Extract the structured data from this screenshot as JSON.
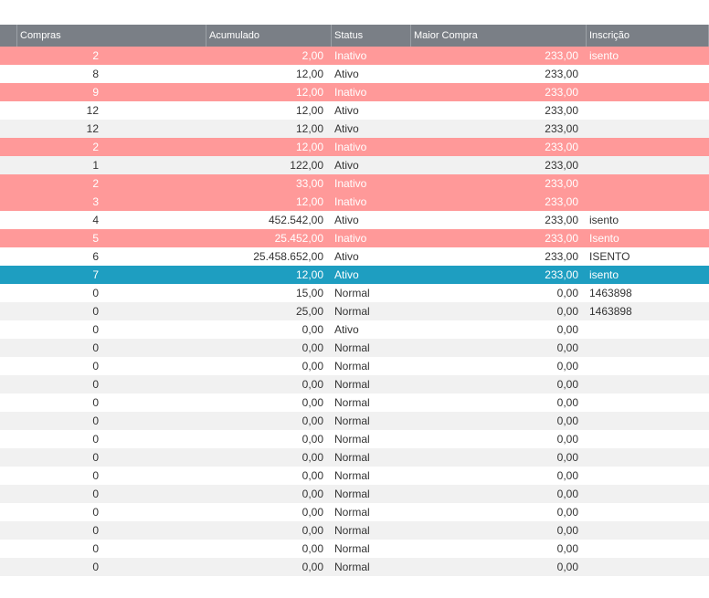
{
  "columns": {
    "compras": "Compras",
    "acumulado": "Acumulado",
    "status": "Status",
    "maior_compra": "Maior Compra",
    "inscricao": "Inscrição"
  },
  "rows": [
    {
      "compras": "2",
      "acumulado": "2,00",
      "status": "Inativo",
      "maior_compra": "233,00",
      "inscricao": "isento",
      "style": "inativo"
    },
    {
      "compras": "8",
      "acumulado": "12,00",
      "status": "Ativo",
      "maior_compra": "233,00",
      "inscricao": "",
      "style": "even"
    },
    {
      "compras": "9",
      "acumulado": "12,00",
      "status": "Inativo",
      "maior_compra": "233,00",
      "inscricao": "",
      "style": "inativo"
    },
    {
      "compras": "12",
      "acumulado": "12,00",
      "status": "Ativo",
      "maior_compra": "233,00",
      "inscricao": "",
      "style": "even"
    },
    {
      "compras": "12",
      "acumulado": "12,00",
      "status": "Ativo",
      "maior_compra": "233,00",
      "inscricao": "",
      "style": "odd"
    },
    {
      "compras": "2",
      "acumulado": "12,00",
      "status": "Inativo",
      "maior_compra": "233,00",
      "inscricao": "",
      "style": "inativo"
    },
    {
      "compras": "1",
      "acumulado": "122,00",
      "status": "Ativo",
      "maior_compra": "233,00",
      "inscricao": "",
      "style": "odd"
    },
    {
      "compras": "2",
      "acumulado": "33,00",
      "status": "Inativo",
      "maior_compra": "233,00",
      "inscricao": "",
      "style": "inativo"
    },
    {
      "compras": "3",
      "acumulado": "12,00",
      "status": "Inativo",
      "maior_compra": "233,00",
      "inscricao": "",
      "style": "inativo"
    },
    {
      "compras": "4",
      "acumulado": "452.542,00",
      "status": "Ativo",
      "maior_compra": "233,00",
      "inscricao": "isento",
      "style": "even"
    },
    {
      "compras": "5",
      "acumulado": "25.452,00",
      "status": "Inativo",
      "maior_compra": "233,00",
      "inscricao": "Isento",
      "style": "inativo"
    },
    {
      "compras": "6",
      "acumulado": "25.458.652,00",
      "status": "Ativo",
      "maior_compra": "233,00",
      "inscricao": "ISENTO",
      "style": "even"
    },
    {
      "compras": "7",
      "acumulado": "12,00",
      "status": "Ativo",
      "maior_compra": "233,00",
      "inscricao": "isento",
      "style": "selected"
    },
    {
      "compras": "0",
      "acumulado": "15,00",
      "status": "Normal",
      "maior_compra": "0,00",
      "inscricao": "1463898",
      "style": "even"
    },
    {
      "compras": "0",
      "acumulado": "25,00",
      "status": "Normal",
      "maior_compra": "0,00",
      "inscricao": "1463898",
      "style": "odd"
    },
    {
      "compras": "0",
      "acumulado": "0,00",
      "status": "Ativo",
      "maior_compra": "0,00",
      "inscricao": "",
      "style": "even"
    },
    {
      "compras": "0",
      "acumulado": "0,00",
      "status": "Normal",
      "maior_compra": "0,00",
      "inscricao": "",
      "style": "odd"
    },
    {
      "compras": "0",
      "acumulado": "0,00",
      "status": "Normal",
      "maior_compra": "0,00",
      "inscricao": "",
      "style": "even"
    },
    {
      "compras": "0",
      "acumulado": "0,00",
      "status": "Normal",
      "maior_compra": "0,00",
      "inscricao": "",
      "style": "odd"
    },
    {
      "compras": "0",
      "acumulado": "0,00",
      "status": "Normal",
      "maior_compra": "0,00",
      "inscricao": "",
      "style": "even"
    },
    {
      "compras": "0",
      "acumulado": "0,00",
      "status": "Normal",
      "maior_compra": "0,00",
      "inscricao": "",
      "style": "odd"
    },
    {
      "compras": "0",
      "acumulado": "0,00",
      "status": "Normal",
      "maior_compra": "0,00",
      "inscricao": "",
      "style": "even"
    },
    {
      "compras": "0",
      "acumulado": "0,00",
      "status": "Normal",
      "maior_compra": "0,00",
      "inscricao": "",
      "style": "odd"
    },
    {
      "compras": "0",
      "acumulado": "0,00",
      "status": "Normal",
      "maior_compra": "0,00",
      "inscricao": "",
      "style": "even"
    },
    {
      "compras": "0",
      "acumulado": "0,00",
      "status": "Normal",
      "maior_compra": "0,00",
      "inscricao": "",
      "style": "odd"
    },
    {
      "compras": "0",
      "acumulado": "0,00",
      "status": "Normal",
      "maior_compra": "0,00",
      "inscricao": "",
      "style": "even"
    },
    {
      "compras": "0",
      "acumulado": "0,00",
      "status": "Normal",
      "maior_compra": "0,00",
      "inscricao": "",
      "style": "odd"
    },
    {
      "compras": "0",
      "acumulado": "0,00",
      "status": "Normal",
      "maior_compra": "0,00",
      "inscricao": "",
      "style": "even"
    },
    {
      "compras": "0",
      "acumulado": "0,00",
      "status": "Normal",
      "maior_compra": "0,00",
      "inscricao": "",
      "style": "odd"
    }
  ],
  "colors": {
    "header_bg": "#7a7f86",
    "inativo_row": "#ff9999",
    "selected_row": "#1e9ec1",
    "alt_row": "#f1f1f1"
  }
}
